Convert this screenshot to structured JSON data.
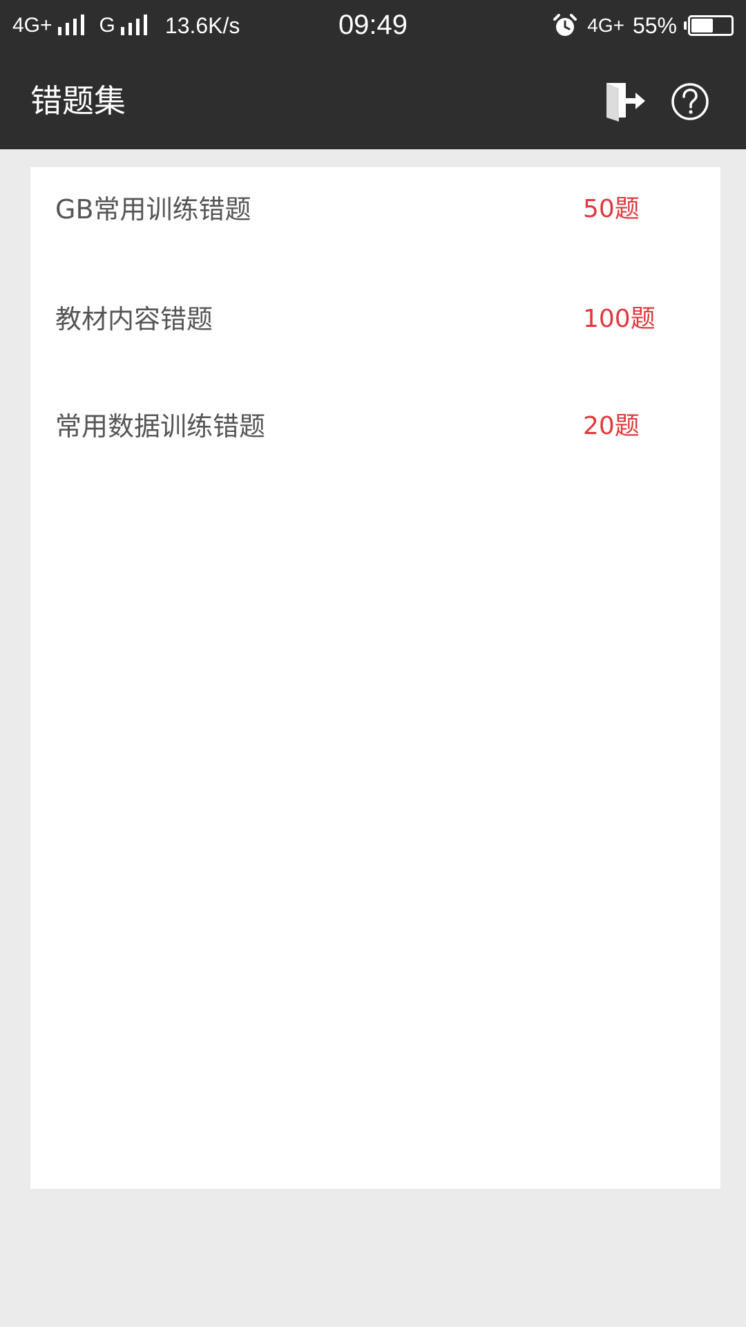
{
  "status_bar": {
    "network1_label": "4G+",
    "network2_label": "G",
    "speed": "13.6K/s",
    "time": "09:49",
    "net4g_label": "4G+",
    "battery_percent_text": "55%",
    "battery_level": 0.55,
    "icons": [
      "signal-icon",
      "alarm-icon",
      "battery-icon"
    ]
  },
  "app_bar": {
    "title": "错题集",
    "icons": [
      "exit-icon",
      "help-icon"
    ]
  },
  "list": {
    "items": [
      {
        "name": "GB常用训练错题",
        "count": "50题"
      },
      {
        "name": "教材内容错题",
        "count": "100题"
      },
      {
        "name": "常用数据训练错题",
        "count": "20题"
      }
    ]
  },
  "colors": {
    "bar_background": "#2e2e2e",
    "page_background": "#ebebeb",
    "card_background": "#ffffff",
    "count_accent": "#e0383c",
    "item_text": "#555555"
  }
}
